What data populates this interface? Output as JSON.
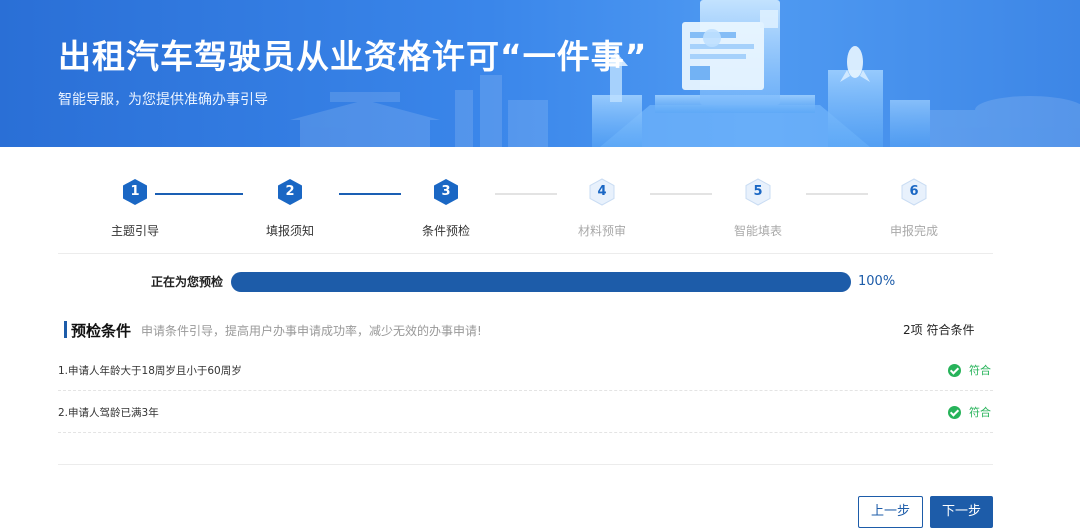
{
  "banner": {
    "title": "出租汽车驾驶员从业资格许可“一件事”",
    "subtitle": "智能导服，为您提供准确办事引导"
  },
  "steps": [
    {
      "num": "1",
      "label": "主题引导",
      "state": "done"
    },
    {
      "num": "2",
      "label": "填报须知",
      "state": "done"
    },
    {
      "num": "3",
      "label": "条件预检",
      "state": "current"
    },
    {
      "num": "4",
      "label": "材料预审",
      "state": "pending"
    },
    {
      "num": "5",
      "label": "智能填表",
      "state": "pending"
    },
    {
      "num": "6",
      "label": "申报完成",
      "state": "pending"
    }
  ],
  "progress": {
    "label": "正在为您预检",
    "percent_text": "100%",
    "value": 1.0
  },
  "precheck": {
    "title": "预检条件",
    "description": "申请条件引导，提高用户办事申请成功率，减少无效的办事申请!",
    "summary": "2项 符合条件",
    "conditions": [
      {
        "text": "1.申请人年龄大于18周岁且小于60周岁",
        "status": "符合"
      },
      {
        "text": "2.申请人驾龄已满3年",
        "status": "符合"
      }
    ]
  },
  "buttons": {
    "prev": "上一步",
    "next": "下一步"
  },
  "colors": {
    "primary": "#1d5ca9",
    "success": "#27b35a",
    "banner": "#3a86ea"
  }
}
